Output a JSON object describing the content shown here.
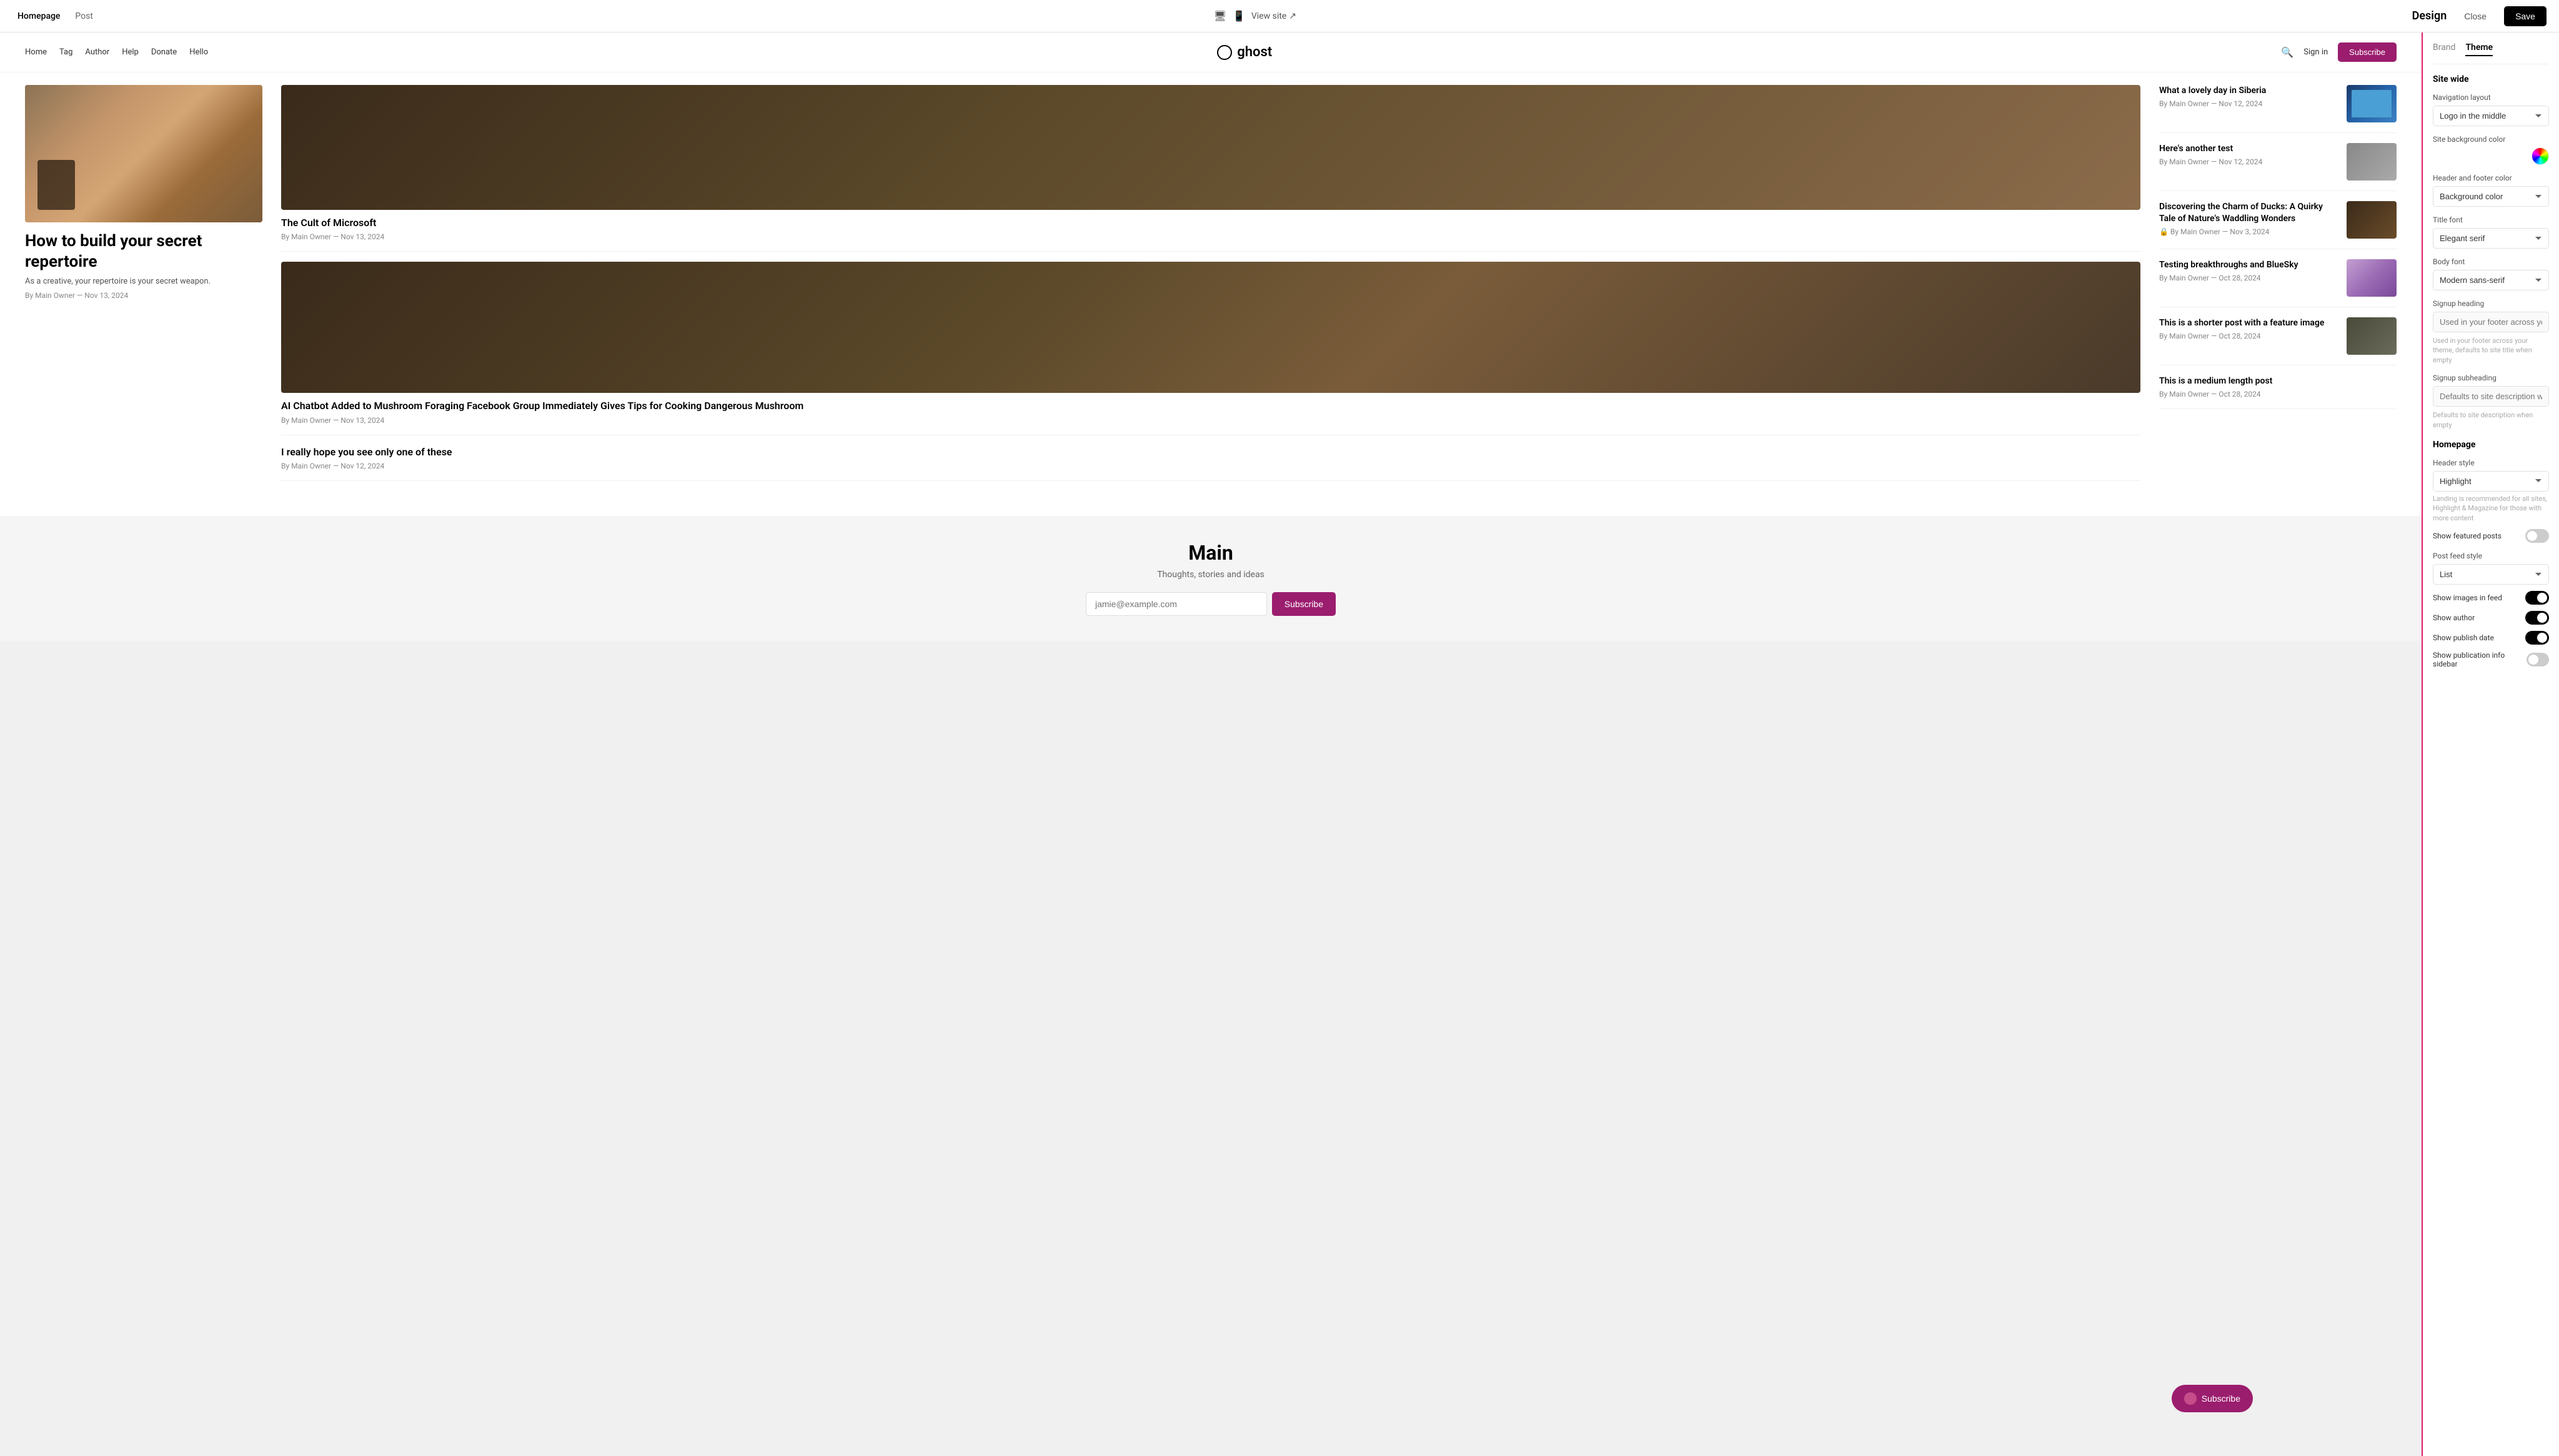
{
  "topBar": {
    "tabs": [
      "Homepage",
      "Post"
    ],
    "activeTab": "Homepage",
    "viewSiteLabel": "View site",
    "designLabel": "Design",
    "closeLabel": "Close",
    "saveLabel": "Save"
  },
  "siteNav": {
    "links": [
      "Home",
      "Tag",
      "Author",
      "Help",
      "Donate",
      "Hello"
    ],
    "logoText": "ghost",
    "signInLabel": "Sign in",
    "subscribeLabel": "Subscribe",
    "emailPlaceholder": "jamie@example.com"
  },
  "featuredPost": {
    "title": "How to build your secret repertoire",
    "excerpt": "As a creative, your repertoire is your secret weapon.",
    "meta": "By Main Owner — Nov 13, 2024"
  },
  "posts": [
    {
      "title": "The Cult of Microsoft",
      "meta": "By Main Owner — Nov 13, 2024",
      "hasImage": false,
      "type": "large"
    },
    {
      "title": "AI Chatbot Added to Mushroom Foraging Facebook Group Immediately Gives Tips for Cooking Dangerous Mushroom",
      "meta": "By Main Owner — Nov 13, 2024",
      "hasImage": false,
      "type": "large"
    },
    {
      "title": "I really hope you see only one of these",
      "meta": "By Main Owner — Nov 12, 2024",
      "hasImage": false,
      "type": "large"
    }
  ],
  "sidePosts": [
    {
      "title": "What a lovely day in Siberia",
      "meta": "By Main Owner — Nov 12, 2024",
      "thumbType": "laptop"
    },
    {
      "title": "Here's another test",
      "meta": "By Main Owner — Nov 12, 2024",
      "thumbType": "person"
    },
    {
      "title": "Discovering the Charm of Ducks: A Quirky Tale of Nature's Waddling Wonders",
      "meta": "🔒 By Main Owner — Nov 3, 2024",
      "thumbType": "mushroom-small"
    },
    {
      "title": "Testing breakthroughs and BlueSky",
      "meta": "By Main Owner — Oct 28, 2024",
      "thumbType": "abstract"
    },
    {
      "title": "This is a shorter post with a feature image",
      "meta": "By Main Owner — Oct 28, 2024",
      "thumbType": "tools"
    },
    {
      "title": "This is a medium length post",
      "meta": "By Main Owner — Oct 28, 2024",
      "thumbType": ""
    }
  ],
  "footer": {
    "title": "Main",
    "description": "Thoughts, stories and ideas",
    "emailPlaceholder": "jamie@example.com",
    "subscribeLabel": "Subscribe"
  },
  "floatingSubscribe": {
    "label": "Subscribe"
  },
  "panel": {
    "tabs": [
      "Brand",
      "Theme"
    ],
    "activeTab": "Theme",
    "siteWideLabel": "Site wide",
    "navigationLayoutLabel": "Navigation layout",
    "navigationLayoutValue": "Logo in the middle",
    "siteBackgroundColorLabel": "Site background color",
    "headerFooterColorLabel": "Header and footer color",
    "headerFooterColorValue": "Background color",
    "titleFontLabel": "Title font",
    "titleFontValue": "Elegant serif",
    "bodyFontLabel": "Body font",
    "bodyFontValue": "Modern sans-serif",
    "signupHeadingLabel": "Signup heading",
    "signupHeadingPlaceholder": "Used in your footer across your theme, defaults to site title when empty",
    "signupSubheadingLabel": "Signup subheading",
    "signupSubheadingPlaceholder": "Defaults to site description when empty",
    "homepageLabel": "Homepage",
    "headerStyleLabel": "Header style",
    "headerStyleValue": "Highlight",
    "headerStyleHelper": "Landing is recommended for all sites, Highlight & Magazine for those with more content",
    "showFeaturedPostsLabel": "Show featured posts",
    "showFeaturedPostsValue": false,
    "postFeedStyleLabel": "Post feed style",
    "postFeedStyleValue": "List",
    "showImagesInFeedLabel": "Show images in feed",
    "showImagesInFeedValue": true,
    "showAuthorLabel": "Show author",
    "showAuthorValue": true,
    "showPublishDateLabel": "Show publish date",
    "showPublishDateValue": true,
    "showPublicationInfoSidebarLabel": "Show publication info sidebar",
    "showPublicationInfoSidebarValue": false
  }
}
